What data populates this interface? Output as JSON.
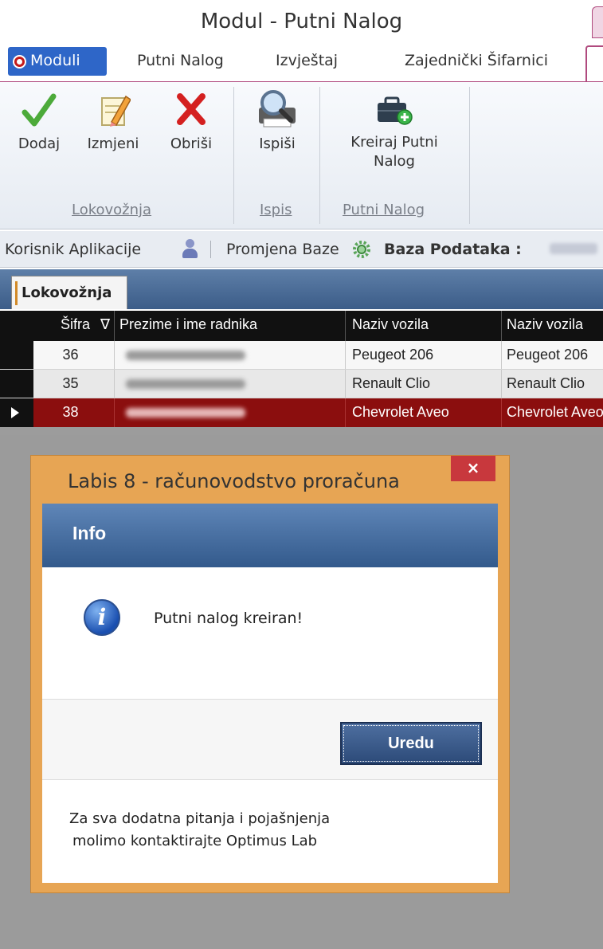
{
  "window": {
    "title": "Modul - Putni Nalog"
  },
  "tabs": [
    {
      "label": "Moduli"
    },
    {
      "label": "Putni Nalog"
    },
    {
      "label": "Izvještaj"
    },
    {
      "label": "Zajednički Šifarnici"
    }
  ],
  "ribbon": {
    "groups": [
      {
        "label": "Lokovožnja",
        "buttons": [
          {
            "label": "Dodaj",
            "icon": "checkmark-icon"
          },
          {
            "label": "Izmjeni",
            "icon": "edit-pencil-icon"
          },
          {
            "label": "Obriši",
            "icon": "delete-x-icon"
          }
        ]
      },
      {
        "label": "Ispis",
        "buttons": [
          {
            "label": "Ispiši",
            "icon": "print-preview-icon"
          }
        ]
      },
      {
        "label": "Putni Nalog",
        "buttons": [
          {
            "label_line1": "Kreiraj Putni",
            "label_line2": "Nalog",
            "icon": "toolbox-add-icon"
          }
        ]
      }
    ]
  },
  "infobar": {
    "user_label": "Korisnik Aplikacije",
    "db_change_label": "Promjena Baze",
    "db_label": "Baza Podataka :"
  },
  "doc_tab": {
    "label": "Lokovožnja"
  },
  "grid": {
    "columns": [
      "Šifra",
      "Prezime i ime radnika",
      "Naziv vozila",
      "Naziv vozila"
    ],
    "sort_indicator": "∇",
    "rows": [
      {
        "sifra": "36",
        "vozilo1": "Peugeot 206",
        "vozilo2": "Peugeot 206"
      },
      {
        "sifra": "35",
        "vozilo1": "Renault Clio",
        "vozilo2": "Renault Clio"
      },
      {
        "sifra": "38",
        "vozilo1": "Chevrolet Aveo",
        "vozilo2": "Chevrolet Aveo"
      }
    ],
    "selected_row": 2,
    "selected_color": "#8b0e0e"
  },
  "dialog": {
    "title": "Labis 8 - računovodstvo proračuna",
    "close_glyph": "×",
    "header": "Info",
    "icon": "info-icon",
    "message": "Putni nalog kreiran!",
    "ok_label": "Uredu",
    "footer_line1": "Za sva dodatna pitanja i pojašnjenja",
    "footer_line2": "molimo kontaktirajte Optimus Lab",
    "frame_color": "#e7a554"
  }
}
